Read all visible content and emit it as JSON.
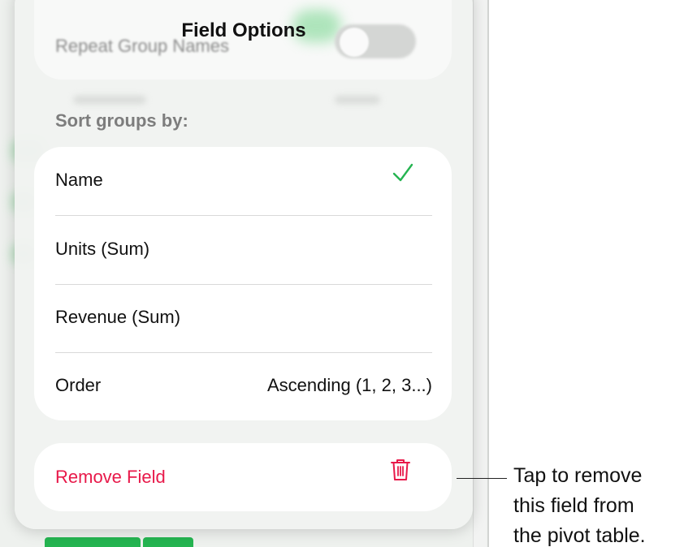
{
  "sheet": {
    "title": "Field Options"
  },
  "top_card": {
    "repeat_label": "Repeat Group Names"
  },
  "sort": {
    "heading": "Sort groups by:",
    "options": [
      {
        "label": "Name",
        "selected": true
      },
      {
        "label": "Units (Sum)",
        "selected": false
      },
      {
        "label": "Revenue (Sum)",
        "selected": false
      }
    ],
    "order": {
      "label": "Order",
      "value": "Ascending (1, 2, 3...)"
    }
  },
  "remove": {
    "label": "Remove Field",
    "icon": "trash-icon"
  },
  "callout": {
    "lines": [
      "Tap to remove",
      "this field from",
      "the pivot table."
    ]
  },
  "colors": {
    "accent_green": "#25b451",
    "destructive_red": "#e8194a",
    "check_green": "#25b451"
  }
}
